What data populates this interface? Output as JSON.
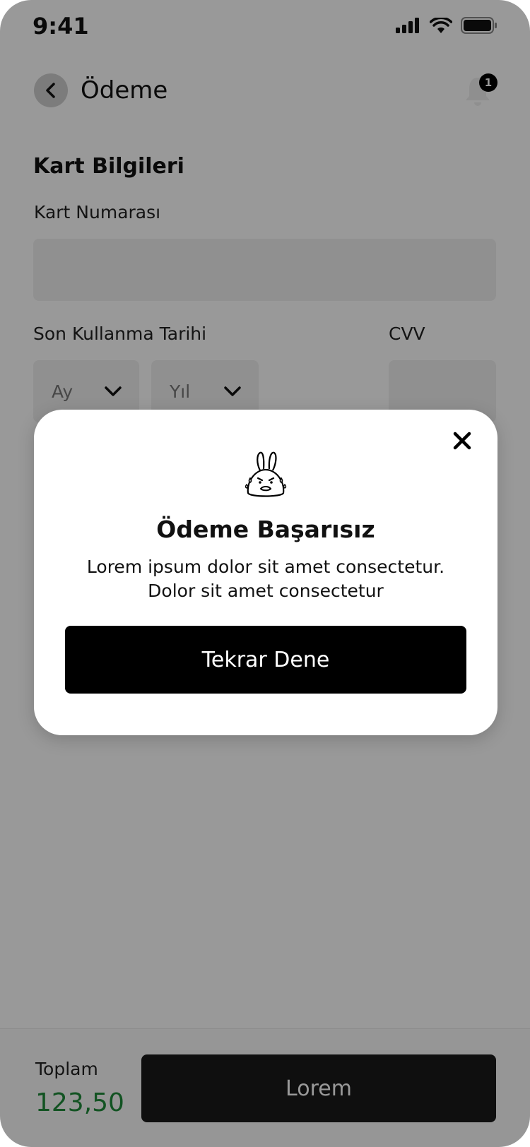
{
  "status_bar": {
    "time": "9:41"
  },
  "header": {
    "title": "Ödeme",
    "notification_count": "1"
  },
  "form": {
    "section_title": "Kart Bilgileri",
    "card_number_label": "Kart Numarası",
    "expiry_label": "Son Kullanma Tarihi",
    "cvv_label": "CVV",
    "month_placeholder": "Ay",
    "year_placeholder": "Yıl"
  },
  "footer": {
    "total_label": "Toplam",
    "total_value": "123,50",
    "button_label": "Lorem"
  },
  "modal": {
    "title": "Ödeme Başarısız",
    "message_line1": "Lorem ipsum dolor sit amet consectetur.",
    "message_line2": "Dolor sit amet consectetur",
    "button_label": "Tekrar Dene"
  },
  "colors": {
    "total_value": "#1f8a3a",
    "primary_button": "#000000",
    "overlay": "#000000"
  },
  "icons": [
    "back-chevron-icon",
    "bell-icon",
    "chevron-down-icon",
    "close-icon",
    "sad-bunny-icon",
    "signal-icon",
    "wifi-icon",
    "battery-icon"
  ]
}
